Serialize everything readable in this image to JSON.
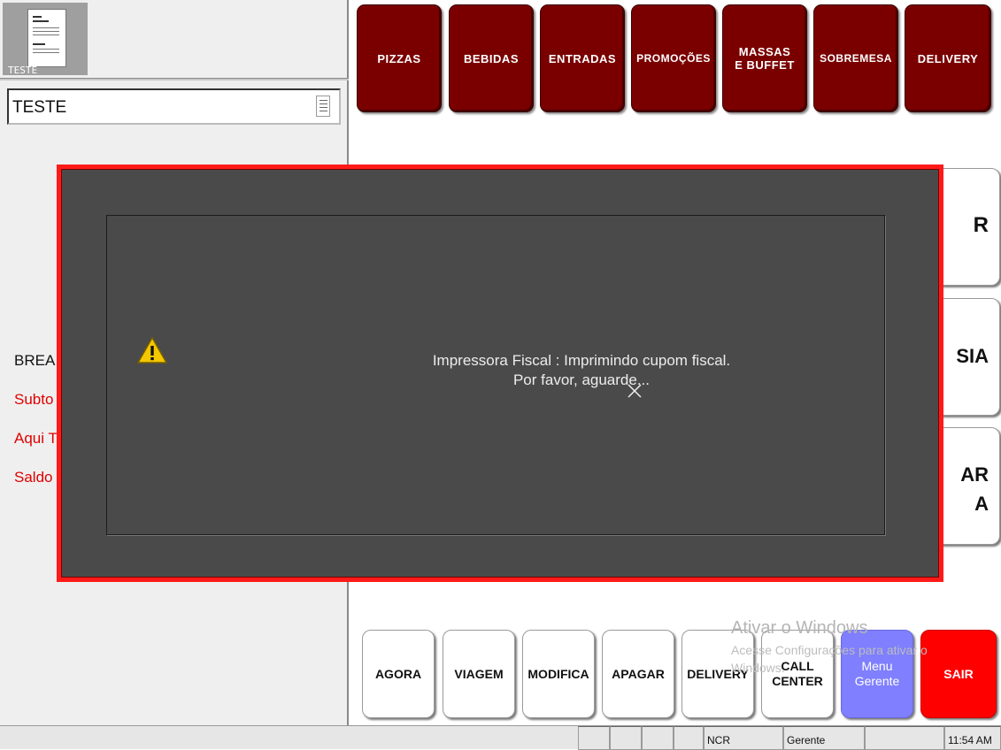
{
  "left_panel": {
    "doc_thumb_label": "TESTE",
    "order_name": "TESTE",
    "lines": {
      "break": "BREA",
      "subtotal": "Subto",
      "aqui": "Aqui T",
      "saldo": "Saldo"
    }
  },
  "categories": [
    "PIZZAS",
    "BEBIDAS",
    "ENTRADAS",
    "PROMOÇÕES",
    "MASSAS\nE BUFFET",
    "SOBREMESA",
    "DELIVERY"
  ],
  "side_buttons": [
    "R",
    "SIA",
    "AR\nA"
  ],
  "bottom_buttons": {
    "agora": "AGORA",
    "viagem": "VIAGEM",
    "modifica": "MODIFICA",
    "apagar": "APAGAR",
    "delivery": "DELIVERY",
    "call_center": "CALL\nCENTER",
    "menu_gerente": "Menu\nGerente",
    "sair": "SAIR"
  },
  "watermark": {
    "line1": "Ativar o Windows",
    "line2": "Acesse Configurações para ativar o",
    "line3": "Windows."
  },
  "status_bar": {
    "operator": "NCR",
    "role": "Gerente",
    "time": "11:54 AM"
  },
  "modal": {
    "message_line1": "Impressora Fiscal : Imprimindo cupom fiscal.",
    "message_line2": "Por favor, aguarde...",
    "icon": "warning-icon",
    "border_color": "#ff1a1a"
  },
  "colors": {
    "category_button": "#7a0000",
    "sair_button": "#ff0000",
    "menu_gerente_button": "#7f7fff",
    "total_text": "#e00000"
  }
}
